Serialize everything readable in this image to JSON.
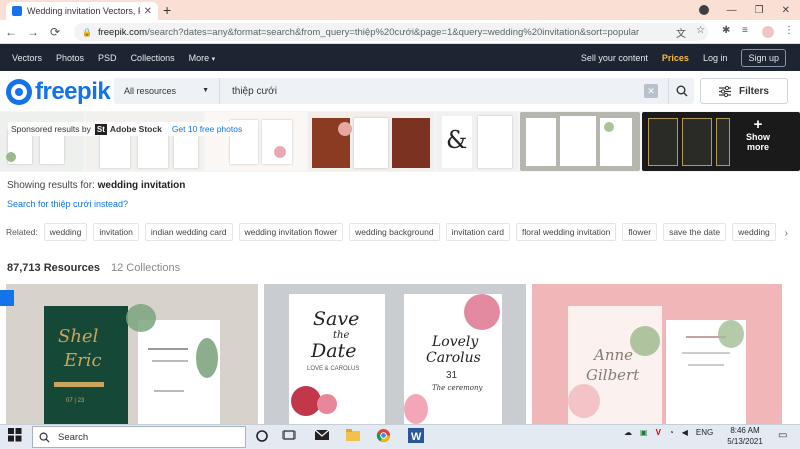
{
  "browser": {
    "tab_title": "Wedding invitation Vectors, Photos",
    "new_tab": "+",
    "url_host": "freepik.com",
    "url_rest": "/search?dates=any&format=search&from_query=thiệp%20cưới&page=1&query=wedding%20invitation&sort=popular"
  },
  "nav": {
    "items": [
      "Vectors",
      "Photos",
      "PSD",
      "Collections",
      "More"
    ],
    "sell": "Sell your content",
    "prices": "Prices",
    "login": "Log in",
    "signup": "Sign up"
  },
  "header": {
    "logo": "freepik",
    "resource_select": "All resources",
    "query": "thiệp cưới",
    "filters": "Filters"
  },
  "sponsored": {
    "label": "Sponsored results by",
    "badge": "St",
    "brand": "Adobe Stock",
    "offer": "Get 10 free photos",
    "show_more_1": "Show",
    "show_more_2": "more"
  },
  "results": {
    "showing_prefix": "Showing results for:",
    "showing_query": "wedding invitation",
    "search_instead": "Search for thiệp cưới instead?",
    "related_label": "Related:",
    "related": [
      "wedding",
      "invitation",
      "indian wedding card",
      "wedding invitation flower",
      "wedding background",
      "invitation card",
      "floral wedding invitation",
      "flower",
      "save the date",
      "wedding"
    ],
    "resources": "87,713 Resources",
    "collections": "12 Collections"
  },
  "cards": [
    {
      "script_1": "Shel",
      "script_2": "Eric"
    },
    {
      "script_1": "Save",
      "script_2": "the",
      "script_3": "Date",
      "sub": "LOVE & CAROLUS"
    },
    {
      "script_1": "Anne",
      "script_2": "Gilbert"
    }
  ],
  "card_text": {
    "c1_lines": "07 | 23",
    "c2_right_1": "Lovely",
    "c2_right_2": "Carolus",
    "c2_right_3": "31",
    "c2_right_4": "The ceremony"
  },
  "taskbar": {
    "search": "Search",
    "lang": "ENG",
    "time": "8:46 AM",
    "date": "5/13/2021"
  }
}
